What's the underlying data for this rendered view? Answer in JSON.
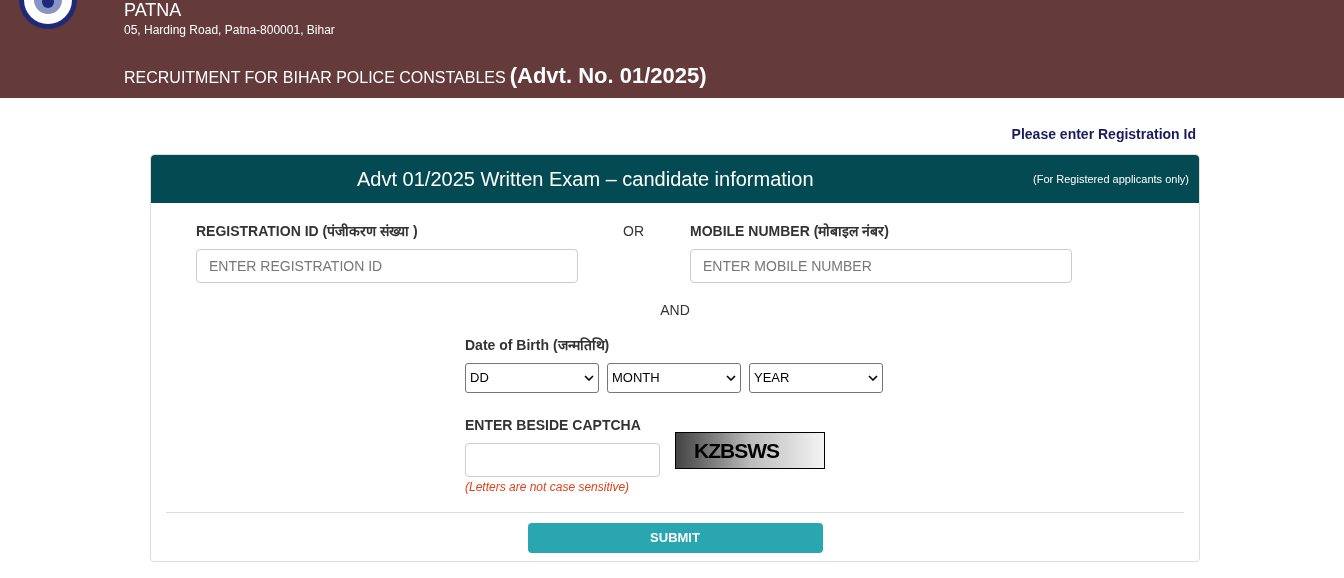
{
  "header": {
    "city": "PATNA",
    "address": "05, Harding Road, Patna-800001, Bihar",
    "recruitment": "RECRUITMENT FOR BIHAR POLICE CONSTABLES",
    "advt": "(Advt. No. 01/2025)"
  },
  "notice": "Please enter Registration Id",
  "card": {
    "title": "Advt 01/2025 Written Exam – candidate information",
    "note": "(For Registered applicants only)",
    "registration": {
      "label": "REGISTRATION ID (पंजीकरण संख्या )",
      "placeholder": "ENTER REGISTRATION ID"
    },
    "or": "OR",
    "mobile": {
      "label": "MOBILE NUMBER (मोबाइल नंबर)",
      "placeholder": "ENTER MOBILE NUMBER"
    },
    "and": "AND",
    "dob": {
      "label": "Date of Birth (जन्मतिथि)",
      "selects": [
        "DD",
        "MONTH",
        "YEAR"
      ]
    },
    "captcha": {
      "label": "ENTER BESIDE CAPTCHA",
      "hint": "(Letters are not case sensitive)",
      "code": "KZBSWS"
    },
    "submit": "SUBMIT"
  }
}
